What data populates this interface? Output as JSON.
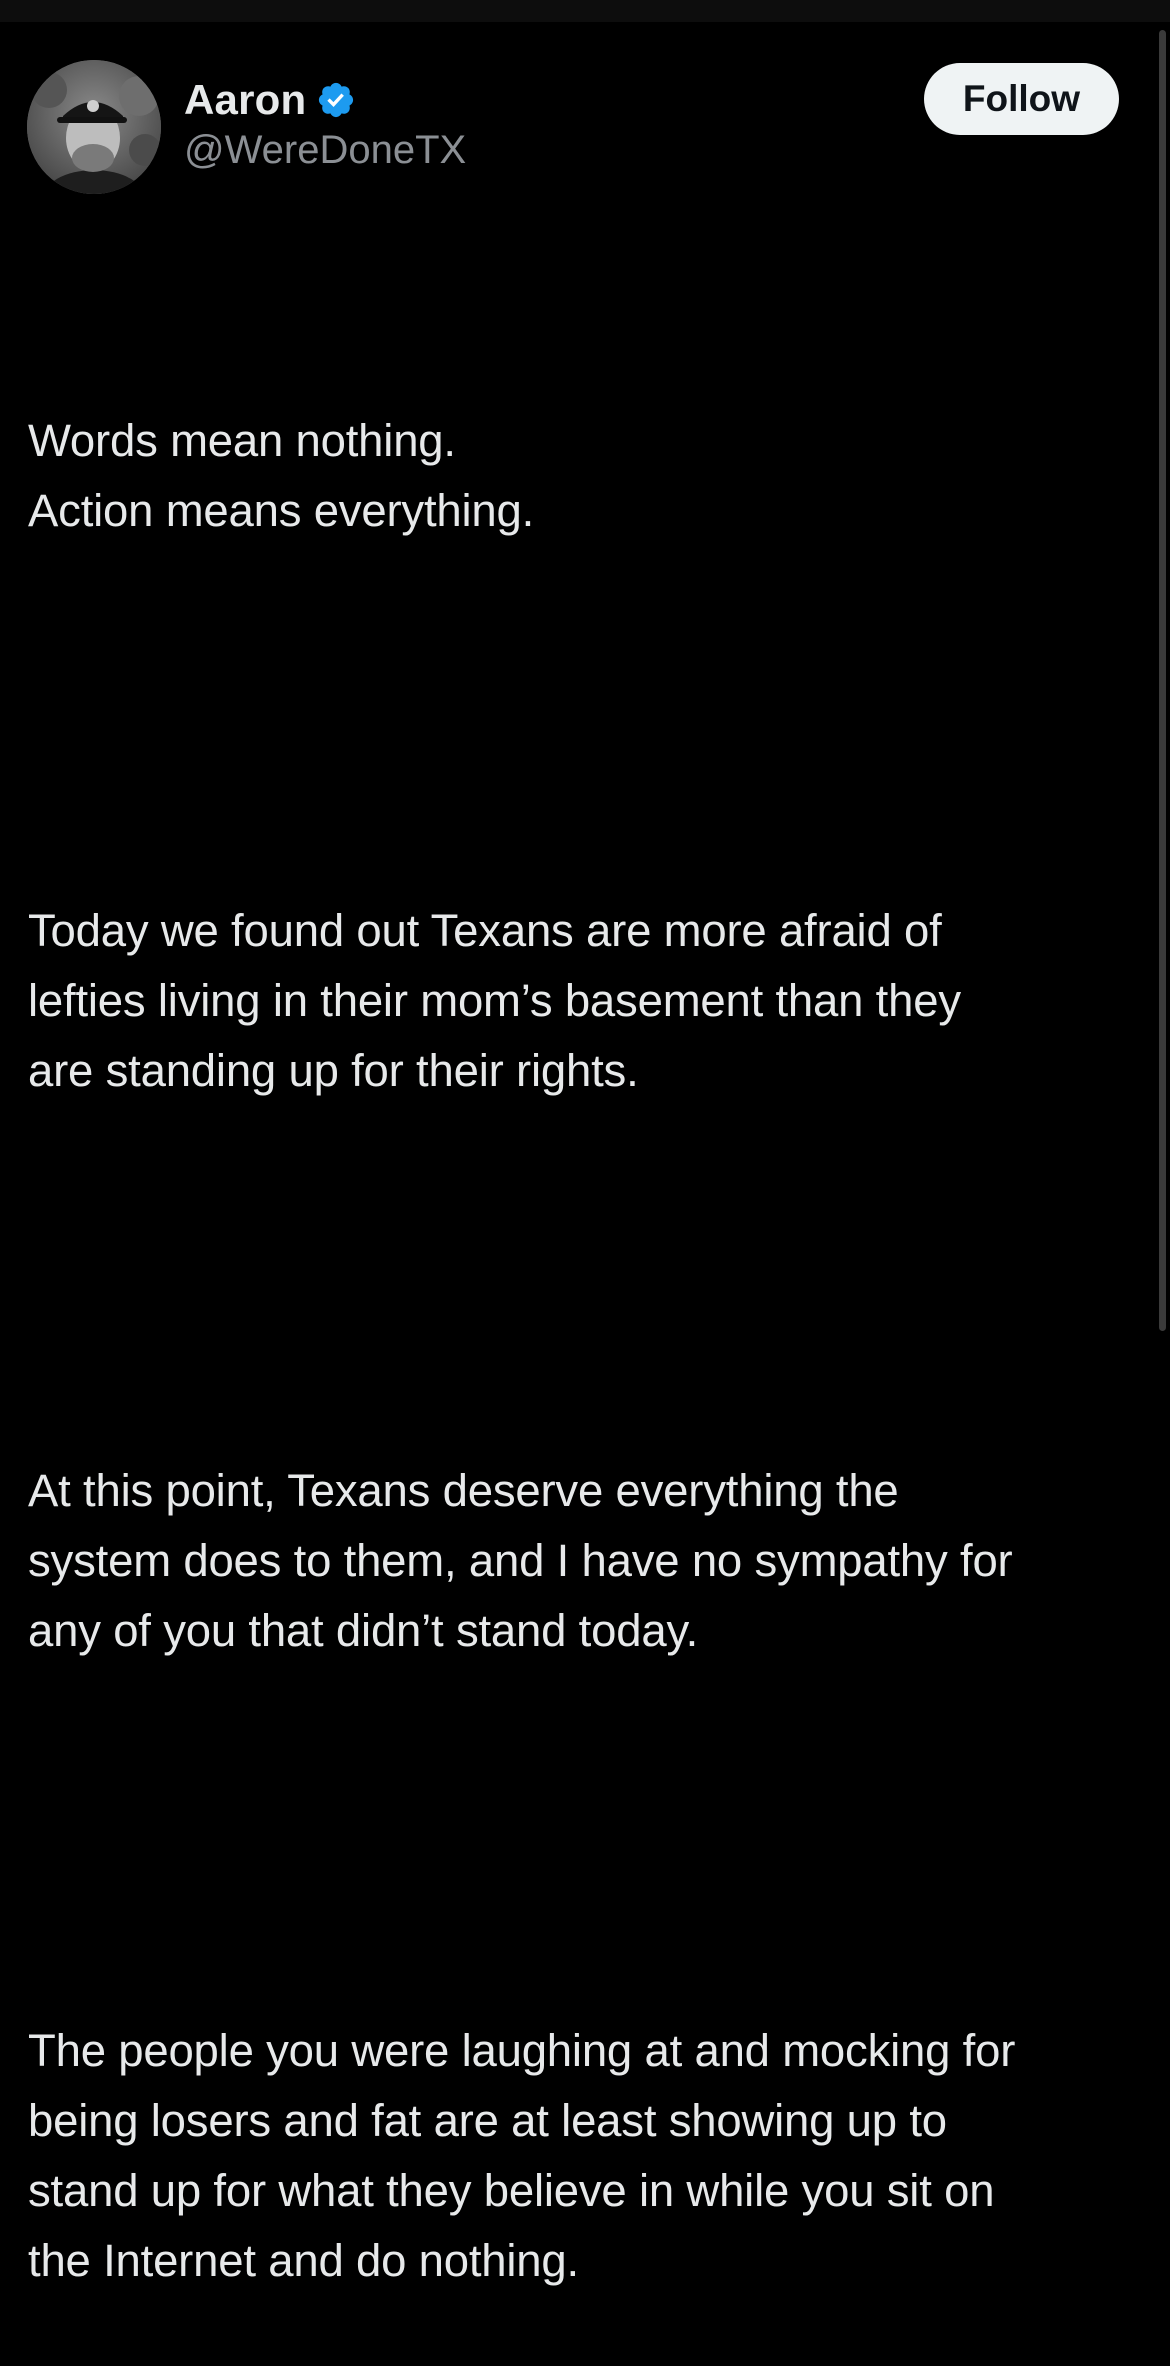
{
  "author": {
    "display_name": "Aaron",
    "handle": "@WereDoneTX",
    "verified": true,
    "avatar": "profile-photo"
  },
  "follow_button": {
    "label": "Follow"
  },
  "tweet": {
    "paragraphs": [
      "Words mean nothing.\nAction means everything.",
      "Today we found out Texans are more afraid of\nlefties living in their mom’s basement than they\nare standing up for their rights.",
      "At this point, Texans deserve everything the\nsystem does to them, and I have no sympathy for\nany of you that didn’t stand today.",
      "The people you were laughing at and mocking for\nbeing losers and fat are at least showing up to\nstand up for what they believe in while you sit on\nthe Internet and do nothing."
    ]
  },
  "colors": {
    "background": "#000000",
    "text_primary": "#e7e9ea",
    "text_secondary": "#8b8f94",
    "verified_badge": "#1d9bf0",
    "follow_button_bg": "#eff3f4",
    "follow_button_text": "#0f1419"
  }
}
